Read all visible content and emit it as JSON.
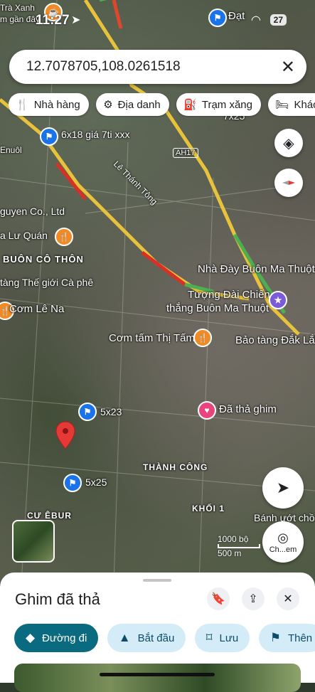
{
  "status": {
    "time": "11:27",
    "battery": "27"
  },
  "search": {
    "query": "12.7078705,108.0261518"
  },
  "chips": [
    {
      "icon": "restaurant-icon",
      "label": "Nhà hàng"
    },
    {
      "icon": "landmark-icon",
      "label": "Địa danh"
    },
    {
      "icon": "gas-station-icon",
      "label": "Trạm xăng"
    },
    {
      "icon": "hotel-icon",
      "label": "Khách"
    }
  ],
  "map_labels": {
    "tra_xanh": "Trà Xanh",
    "gan_day": "m gần đây",
    "dat": "Đạt",
    "pin_6x18": "6x18 giá 7ti xxx",
    "enuol": "Enuôl",
    "ah17": "AH17",
    "le_thanh_tong": "Lê Thánh Tông",
    "nguyen_co": "guyen Co., Ltd",
    "lu_quan": "a Lư Quán",
    "buon_co_thon": "BUÔN CÔ THÔN",
    "nha_day": "Nhà Đày Buôn Ma Thuột",
    "the_gioi_ca_phe": "tàng Thế giới Cà phê",
    "tuong_dai": "Tượng Đài Chiến",
    "thang_bmt": "thắng Buôn Ma Thuột",
    "com_le_na": "Cơm Lê Na",
    "com_tam": "Cơm tấm Thị Tấm",
    "bao_tang": "Bảo tàng Đắk Lắk",
    "pin_5x23": "5x23",
    "da_tha_ghim": "Đã thả ghim",
    "thanh_cong": "THÀNH CÔNG",
    "pin_5x25": "5x25",
    "khoi_1": "KHỐI 1",
    "cu_ebur": "CƯ ÊBUR",
    "banh_uot": "Bánh ướt chồ",
    "x25": "7x25",
    "map_scale": "1000 bộ",
    "scale_m": "500 m",
    "translate_label": "Ch...em"
  },
  "sheet": {
    "title": "Ghim đã thả",
    "actions": [
      {
        "icon": "directions-icon",
        "label": "Đường đi"
      },
      {
        "icon": "navigation-arrow-icon",
        "label": "Bắt đầu"
      },
      {
        "icon": "bookmark-icon",
        "label": "Lưu"
      },
      {
        "icon": "flag-icon",
        "label": "Thên"
      }
    ]
  }
}
